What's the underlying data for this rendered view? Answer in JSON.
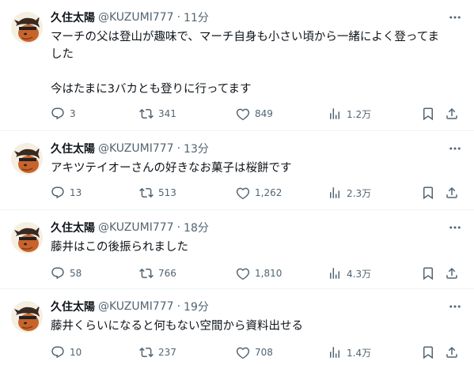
{
  "tweets": [
    {
      "author": "久住太陽",
      "handle": "@KUZUMI777",
      "separator": "·",
      "time": "11分",
      "text": "マーチの父は登山が趣味で、マーチ自身も小さい頃から一緒によく登ってま\nした\n\n今はたまに3バカとも登りに行ってます",
      "replies": "3",
      "retweets": "341",
      "likes": "849",
      "views": "1.2万"
    },
    {
      "author": "久住太陽",
      "handle": "@KUZUMI777",
      "separator": "·",
      "time": "13分",
      "text": "アキツテイオーさんの好きなお菓子は桜餅です",
      "replies": "13",
      "retweets": "513",
      "likes": "1,262",
      "views": "2.3万"
    },
    {
      "author": "久住太陽",
      "handle": "@KUZUMI777",
      "separator": "·",
      "time": "18分",
      "text": "藤井はこの後振られました",
      "replies": "58",
      "retweets": "766",
      "likes": "1,810",
      "views": "4.3万"
    },
    {
      "author": "久住太陽",
      "handle": "@KUZUMI777",
      "separator": "·",
      "time": "19分",
      "text": "藤井くらいになると何もない空間から資料出せる",
      "replies": "10",
      "retweets": "237",
      "likes": "708",
      "views": "1.4万"
    }
  ],
  "icons": {
    "reply": "speech-bubble",
    "retweet": "retweet-arrows",
    "like": "heart-outline",
    "views": "bar-chart",
    "bookmark": "bookmark",
    "share": "upload-arrow",
    "more": "three-dots"
  },
  "colors": {
    "text": "#0f1419",
    "muted": "#536471",
    "divider": "#eff3f4"
  }
}
